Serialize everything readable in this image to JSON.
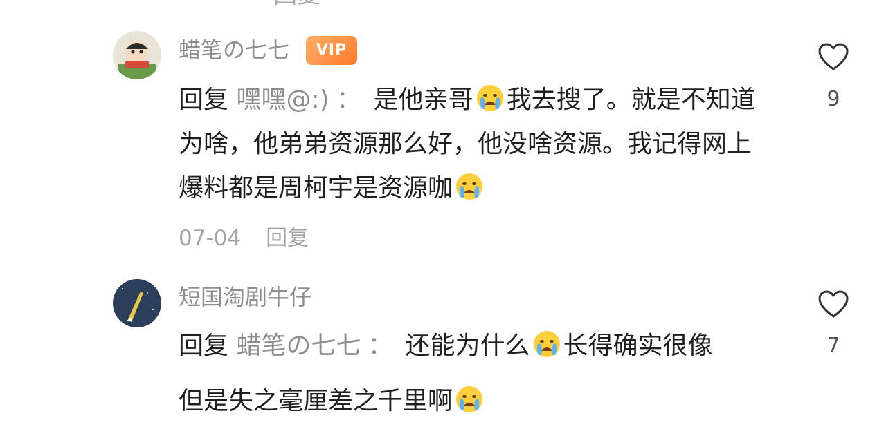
{
  "top_cut_text": "回复",
  "comments": [
    {
      "username": "蜡笔の七七",
      "badge": "VIP",
      "reply_word": "回复",
      "reply_target": "嘿嘿@:)",
      "colon": "：",
      "text_1": "是他亲哥",
      "text_2": "我去搜了。就是不知道为啥，他弟弟资源那么好，他没啥资源。我记得网上爆料都是周柯宇是资源咖",
      "date": "07-04",
      "reply_link": "回复",
      "likes": "9"
    },
    {
      "username": "短国淘剧牛仔",
      "reply_word": "回复",
      "reply_target": "蜡笔の七七",
      "colon": "：",
      "text_1": "还能为什么",
      "text_2": "长得确实很像",
      "text_3": "但是失之毫厘差之千里啊",
      "likes": "7"
    }
  ],
  "icons": {
    "like": "heart-outline-icon",
    "emoji": "crying-face-emoji"
  },
  "colors": {
    "username": "#8e8e8e",
    "vip_badge": "#ff8a3d",
    "body_text": "#1f1f1f",
    "meta_text": "#a4a4a4"
  }
}
